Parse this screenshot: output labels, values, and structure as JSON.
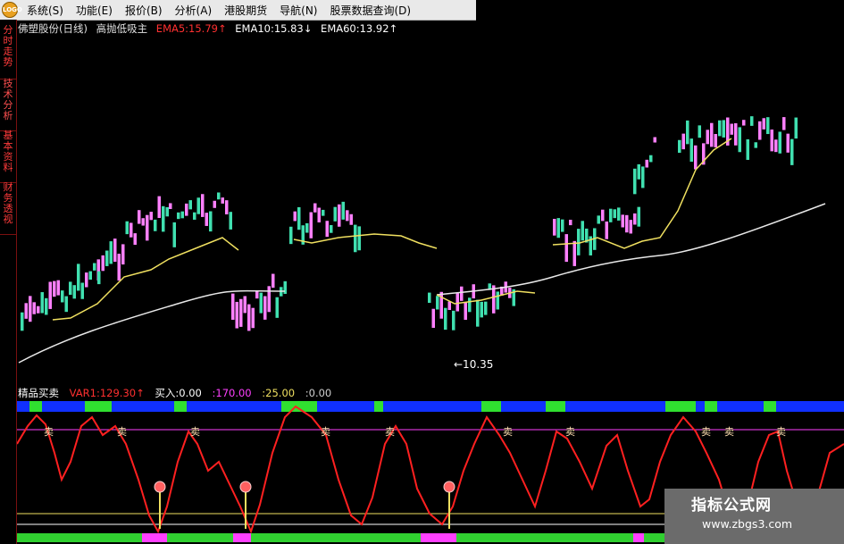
{
  "app": {
    "logo_text": "LOGO"
  },
  "menubar": {
    "items": [
      "系统(S)",
      "功能(E)",
      "报价(B)",
      "分析(A)",
      "港股期货",
      "导航(N)",
      "股票数据查询(D)"
    ]
  },
  "sidebar": {
    "tabs": [
      "分时走势",
      "技术分析",
      "基本资料",
      "财务透视"
    ]
  },
  "price_panel": {
    "stock_name": "佛塑股份(日线)",
    "indicator_name": "高抛低吸主",
    "ema5": "EMA5:15.79↑",
    "ema10": "EMA10:15.83↓",
    "ema60": "EMA60:13.92↑",
    "low_marker": "←10.35",
    "colors": {
      "ema5": "#ff3030",
      "ema10": "#ffffff",
      "ema60": "#ffffff",
      "bull": "#ff80ff",
      "bear": "#40e0b0"
    }
  },
  "indicator_panel": {
    "name": "精品买卖",
    "var1": "VAR1:129.30↑",
    "buy": "买入:0.00",
    "v170": ":170.00",
    "v25": ":25.00",
    "v0": ":0.00",
    "sell_marker": "卖"
  },
  "watermark": {
    "title": "指标公式网",
    "url": "www.zbgs3.com"
  }
}
